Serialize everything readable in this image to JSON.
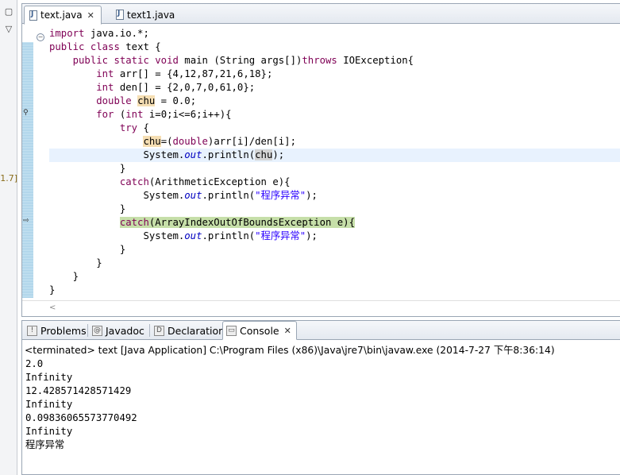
{
  "left_strip": {
    "restore_symbol": "▢",
    "menu_symbol": "▽",
    "label": "1.7]"
  },
  "editor": {
    "tabs": [
      {
        "label": "text.java",
        "close": "✕",
        "active": true
      },
      {
        "label": "text1.java",
        "active": false
      }
    ],
    "lines": [
      [
        {
          "t": "import",
          "c": "kw"
        },
        {
          "t": " java.io.*;"
        }
      ],
      [
        {
          "t": "public",
          "c": "kw"
        },
        {
          "t": " "
        },
        {
          "t": "class",
          "c": "kw"
        },
        {
          "t": " text {"
        }
      ],
      [
        {
          "t": "    "
        },
        {
          "t": "public",
          "c": "kw"
        },
        {
          "t": " "
        },
        {
          "t": "static",
          "c": "kw"
        },
        {
          "t": " "
        },
        {
          "t": "void",
          "c": "kw"
        },
        {
          "t": " main (String args[])"
        },
        {
          "t": "throws",
          "c": "kw"
        },
        {
          "t": " IOException{"
        }
      ],
      [
        {
          "t": "        "
        },
        {
          "t": "int",
          "c": "kw"
        },
        {
          "t": " arr[] = {4,12,87,21,6,18};"
        }
      ],
      [
        {
          "t": "        "
        },
        {
          "t": "int",
          "c": "kw"
        },
        {
          "t": " den[] = {2,0,7,0,61,0};"
        }
      ],
      [
        {
          "t": "        "
        },
        {
          "t": "double",
          "c": "kw"
        },
        {
          "t": " "
        },
        {
          "t": "chu",
          "c": "occ"
        },
        {
          "t": " = 0.0;"
        }
      ],
      [
        {
          "t": "        "
        },
        {
          "t": "for",
          "c": "kw"
        },
        {
          "t": " ("
        },
        {
          "t": "int",
          "c": "kw"
        },
        {
          "t": " i=0;i<=6;i++){"
        }
      ],
      [
        {
          "t": "            "
        },
        {
          "t": "try",
          "c": "kw"
        },
        {
          "t": " {"
        }
      ],
      [
        {
          "t": "                "
        },
        {
          "t": "chu",
          "c": "occ"
        },
        {
          "t": "=("
        },
        {
          "t": "double",
          "c": "kw"
        },
        {
          "t": ")arr[i]/den[i];"
        }
      ],
      [
        {
          "t": "                System."
        },
        {
          "t": "out",
          "c": "fld"
        },
        {
          "t": ".println("
        },
        {
          "t": "chu",
          "c": "occ2"
        },
        {
          "t": ");"
        }
      ],
      [
        {
          "t": "            }"
        }
      ],
      [
        {
          "t": "            "
        },
        {
          "t": "catch",
          "c": "kw"
        },
        {
          "t": "(ArithmeticException e){"
        }
      ],
      [
        {
          "t": "                System."
        },
        {
          "t": "out",
          "c": "fld"
        },
        {
          "t": ".println("
        },
        {
          "t": "\"程序异常\"",
          "c": "str"
        },
        {
          "t": ");"
        }
      ],
      [
        {
          "t": "            }"
        }
      ],
      [
        {
          "t": "            "
        },
        {
          "t": "catch",
          "c": "kw"
        },
        {
          "t": "(ArrayIndexOutOfBoundsException e){"
        }
      ],
      [
        {
          "t": "                System."
        },
        {
          "t": "out",
          "c": "fld"
        },
        {
          "t": ".println("
        },
        {
          "t": "\"程序异常\"",
          "c": "str"
        },
        {
          "t": ");"
        }
      ],
      [
        {
          "t": "            }"
        }
      ],
      [
        {
          "t": "        }"
        }
      ],
      [
        {
          "t": "    }"
        }
      ],
      [
        {
          "t": "}"
        }
      ]
    ],
    "current_line_index": 9,
    "debug_line_index": 14,
    "scroll_arrow": "<"
  },
  "views": {
    "tabs": [
      {
        "label": "Problems",
        "icon": "problems-icon",
        "glyph": "!"
      },
      {
        "label": "Javadoc",
        "icon": "javadoc-icon",
        "glyph": "@"
      },
      {
        "label": "Declaration",
        "icon": "declaration-icon",
        "glyph": "D"
      },
      {
        "label": "Console",
        "icon": "console-icon",
        "glyph": "▭",
        "active": true,
        "close": "✕"
      }
    ],
    "terminated_line": "<terminated> text [Java Application] C:\\Program Files (x86)\\Java\\jre7\\bin\\javaw.exe (2014-7-27 下午8:36:14)",
    "output": [
      "2.0",
      "Infinity",
      "12.428571428571429",
      "Infinity",
      "0.09836065573770492",
      "Infinity",
      "程序异常"
    ]
  }
}
